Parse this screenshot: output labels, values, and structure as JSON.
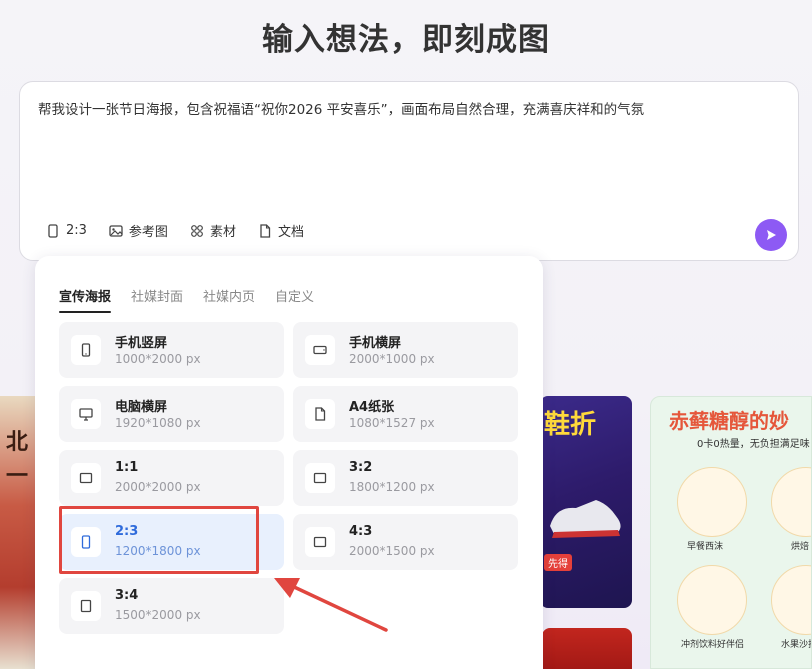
{
  "header": {
    "title": "输入想法，即刻成图"
  },
  "prompt": {
    "text": "帮我设计一张节日海报，包含祝福语“祝你2026 平安喜乐”，画面布局自然合理，充满喜庆祥和的气氛"
  },
  "toolbar": {
    "ratio_label": "2:3",
    "reference_label": "参考图",
    "material_label": "素材",
    "document_label": "文档"
  },
  "dropdown": {
    "tabs": [
      {
        "label": "宣传海报",
        "active": true
      },
      {
        "label": "社媒封面",
        "active": false
      },
      {
        "label": "社媒内页",
        "active": false
      },
      {
        "label": "自定义",
        "active": false
      }
    ],
    "options": [
      {
        "name": "手机竖屏",
        "dim": "1000*2000 px",
        "icon": "phone-portrait-icon"
      },
      {
        "name": "手机横屏",
        "dim": "2000*1000 px",
        "icon": "phone-landscape-icon"
      },
      {
        "name": "电脑横屏",
        "dim": "1920*1080 px",
        "icon": "monitor-icon"
      },
      {
        "name": "A4纸张",
        "dim": "1080*1527 px",
        "icon": "document-icon"
      },
      {
        "name": "1:1",
        "dim": "2000*2000 px",
        "icon": "ratio-rect-icon"
      },
      {
        "name": "3:2",
        "dim": "1800*1200 px",
        "icon": "ratio-rect-icon"
      },
      {
        "name": "2:3",
        "dim": "1200*1800 px",
        "icon": "ratio-portrait-icon",
        "selected": true
      },
      {
        "name": "4:3",
        "dim": "2000*1500 px",
        "icon": "ratio-rect-icon"
      },
      {
        "name": "3:4",
        "dim": "1500*2000 px",
        "icon": "ratio-rect-icon"
      }
    ]
  },
  "gallery": {
    "left_chars": [
      "北",
      "一"
    ],
    "shoe_text": "鞋折",
    "shoe_tag": "先得",
    "food_title": "赤藓糖醇的妙",
    "food_sub": "0卡0热量，无负担满足味",
    "food_labels": [
      "早餐西沫",
      "烘焙",
      "冲剂饮料好伴侣",
      "水果沙拉"
    ]
  },
  "colors": {
    "accent": "#8d5af4",
    "selected_text": "#2f6bdb",
    "highlight": "#e0463f"
  }
}
